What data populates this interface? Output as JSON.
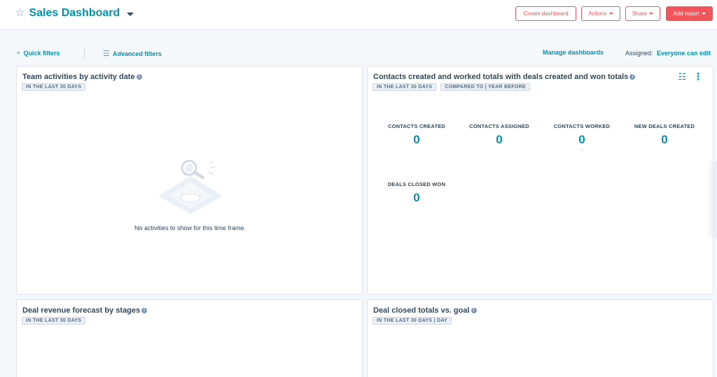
{
  "header": {
    "title": "Sales Dashboard",
    "buttons": {
      "create_dashboard": "Create dashboard",
      "actions": "Actions",
      "share": "Share",
      "add_report": "Add report"
    }
  },
  "filters": {
    "quick_filters": "Quick filters",
    "advanced_filters": "Advanced filters",
    "manage_dashboards": "Manage dashboards",
    "assigned_label": "Assigned:",
    "assigned_value": "Everyone can edit"
  },
  "cards": {
    "team_activities": {
      "title": "Team activities by activity date",
      "tag": "IN THE LAST 30 DAYS",
      "empty_message": "No activities to show for this time frame."
    },
    "contacts_worked": {
      "title": "Contacts created and worked totals with deals created and won totals",
      "tags": [
        "IN THE LAST 30 DAYS",
        "COMPARED TO | YEAR BEFORE"
      ],
      "metrics": [
        {
          "label": "CONTACTS CREATED",
          "value": "0",
          "sub": ""
        },
        {
          "label": "CONTACTS ASSIGNED",
          "value": "0",
          "sub": ""
        },
        {
          "label": "CONTACTS WORKED",
          "value": "0",
          "sub": "-"
        },
        {
          "label": "NEW DEALS CREATED",
          "value": "0",
          "sub": ""
        },
        {
          "label": "DEALS CLOSED WON",
          "value": "0",
          "sub": ""
        }
      ]
    },
    "deal_revenue": {
      "title": "Deal revenue forecast by stages",
      "tag": "IN THE LAST 30 DAYS"
    },
    "deal_closed": {
      "title": "Deal closed totals vs. goal",
      "tag": "IN THE LAST 30 DAYS | DAY"
    }
  },
  "icons": {
    "favorite": "star-outline-icon",
    "info": "info-icon",
    "filter": "filter-icon",
    "kebab": "more-vertical-icon"
  },
  "colors": {
    "accent": "#0091ae",
    "primary_button": "#f2545b",
    "text": "#33475b",
    "tag_bg": "#eaf0f6"
  }
}
